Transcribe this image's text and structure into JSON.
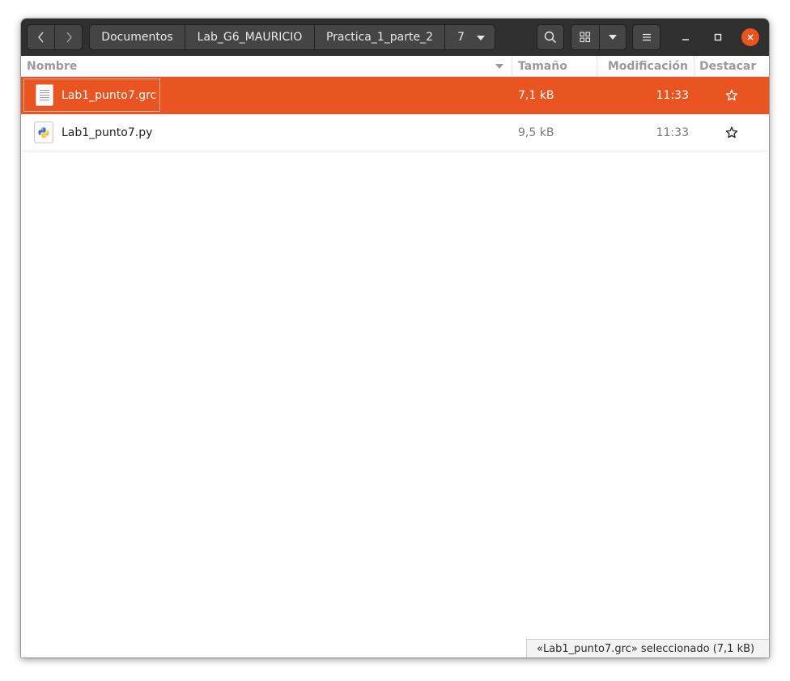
{
  "breadcrumbs": [
    "Documentos",
    "Lab_G6_MAURICIO",
    "Practica_1_parte_2",
    "7"
  ],
  "columns": {
    "name": "Nombre",
    "size": "Tamaño",
    "modified": "Modificación",
    "star": "Destacar"
  },
  "files": [
    {
      "name": "Lab1_punto7.grc",
      "size": "7,1 kB",
      "modified": "11:33",
      "icon": "text-file-icon",
      "selected": true
    },
    {
      "name": "Lab1_punto7.py",
      "size": "9,5 kB",
      "modified": "11:33",
      "icon": "python-file-icon",
      "selected": false
    }
  ],
  "status": "«Lab1_punto7.grc» seleccionado  (7,1 kB)",
  "colors": {
    "accent": "#e95420",
    "headerbar": "#303030"
  },
  "icons": [
    "back-icon",
    "forward-icon",
    "search-icon",
    "grid-view-icon",
    "chevron-down-icon",
    "hamburger-menu-icon",
    "minimize-icon",
    "maximize-icon",
    "close-icon",
    "star-icon"
  ]
}
